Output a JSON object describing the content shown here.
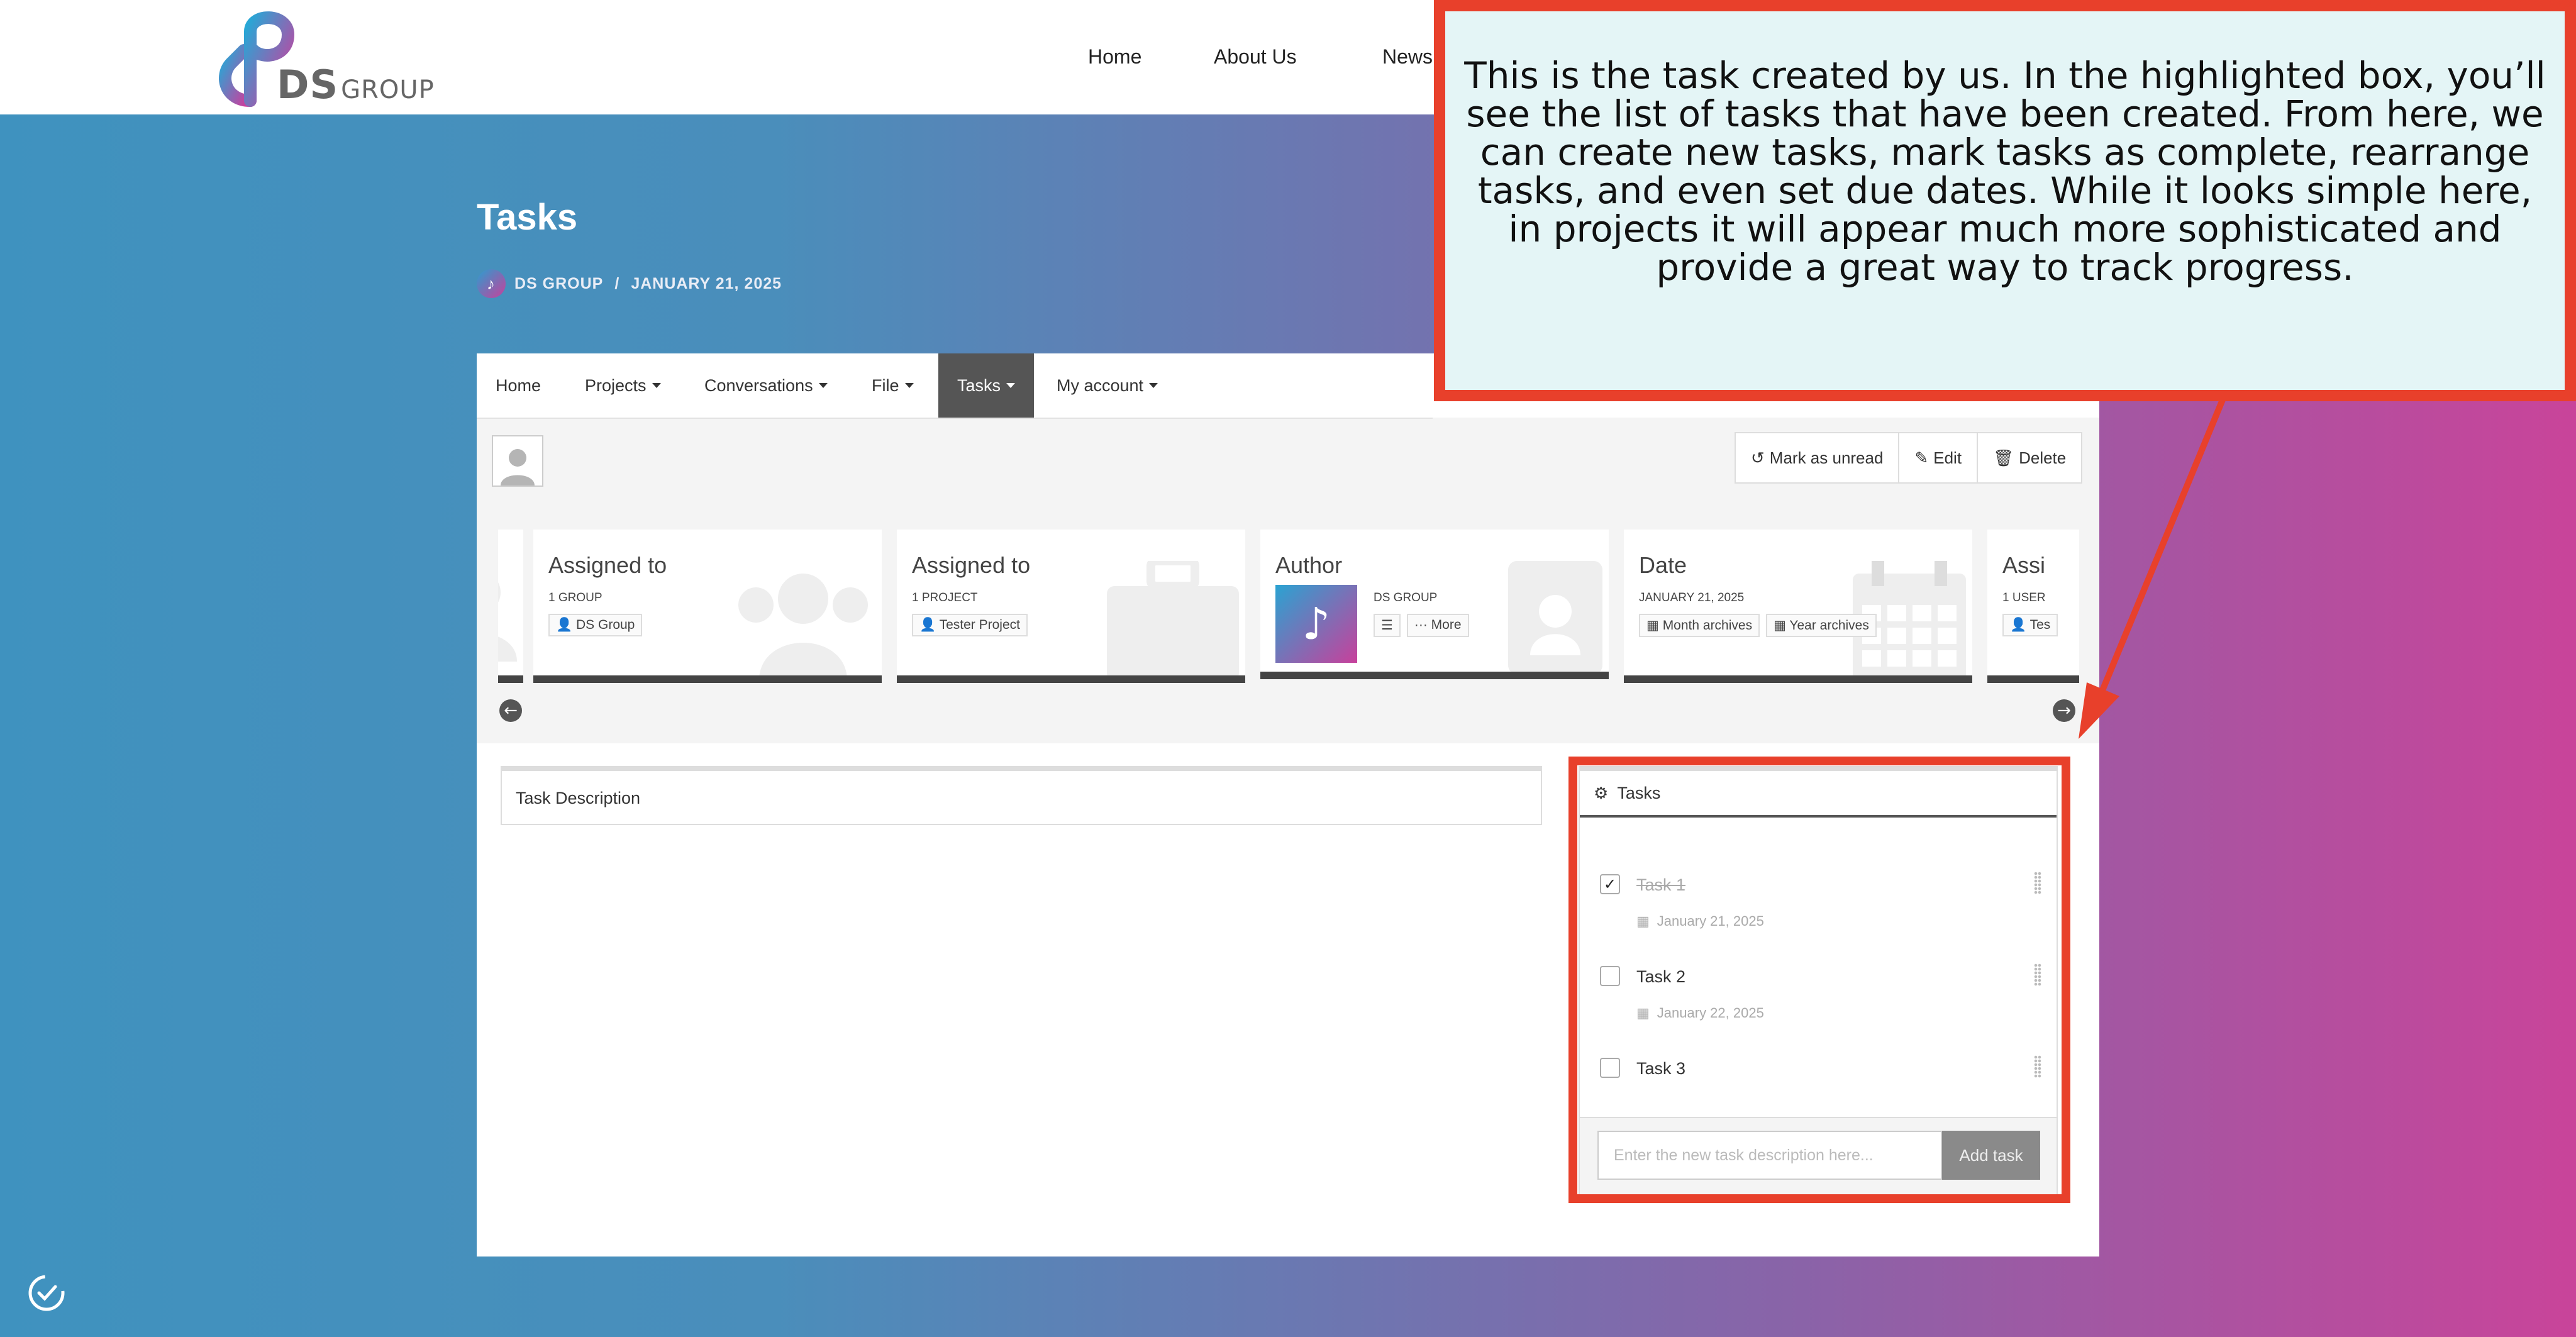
{
  "brand": {
    "logo_text": "DS",
    "logo_sub": "GROUP"
  },
  "nav": {
    "items": [
      "Home",
      "About Us",
      "News"
    ]
  },
  "page": {
    "title": "Tasks",
    "author": "DS GROUP",
    "date": "JANUARY 21, 2025"
  },
  "menu": {
    "items": [
      {
        "label": "Home",
        "dropdown": false
      },
      {
        "label": "Projects",
        "dropdown": true
      },
      {
        "label": "Conversations",
        "dropdown": true
      },
      {
        "label": "File",
        "dropdown": true
      },
      {
        "label": "Tasks",
        "dropdown": true,
        "active": true
      },
      {
        "label": "My account",
        "dropdown": true
      }
    ]
  },
  "actions": {
    "mark_unread": "Mark as unread",
    "edit": "Edit",
    "delete": "Delete"
  },
  "info_tiles": [
    {
      "title": "Assigned to",
      "subtitle": "1 GROUP",
      "chips": [
        "DS Group"
      ],
      "icon": "group-icon"
    },
    {
      "title": "Assigned to",
      "subtitle": "1 PROJECT",
      "chips": [
        "Tester Project"
      ],
      "icon": "briefcase-icon"
    },
    {
      "title": "Author",
      "subtitle": "DS GROUP",
      "chips": [
        "",
        "More"
      ],
      "icon": "badge-icon"
    },
    {
      "title": "Date",
      "subtitle": "JANUARY 21, 2025",
      "chips": [
        "Month archives",
        "Year archives"
      ],
      "icon": "calendar-icon"
    },
    {
      "title": "Assi",
      "subtitle": "1 USER",
      "chips": [
        "Tes"
      ],
      "icon": "user-icon"
    }
  ],
  "description": {
    "label": "Task Description"
  },
  "tasks_widget": {
    "title": "Tasks",
    "tasks": [
      {
        "name": "Task 1",
        "done": true,
        "due": "January 21, 2025"
      },
      {
        "name": "Task 2",
        "done": false,
        "due": "January 22, 2025"
      },
      {
        "name": "Task 3",
        "done": false,
        "due": ""
      }
    ],
    "input_placeholder": "Enter the new task description here...",
    "add_label": "Add task"
  },
  "callout": {
    "text": "This is the task created by us. In the highlighted box, you’ll see the list of tasks that have been created. From here, we can create new tasks, mark tasks as complete, rearrange tasks, and even set due dates. While it looks simple here, in projects it will appear much more sophisticated and provide a great way to track progress."
  },
  "colors": {
    "highlight": "#e8402b",
    "callout_bg": "#e4f5f6",
    "gradient_start": "#3f92bf",
    "gradient_end": "#c9449a",
    "active_tab": "#555555"
  }
}
